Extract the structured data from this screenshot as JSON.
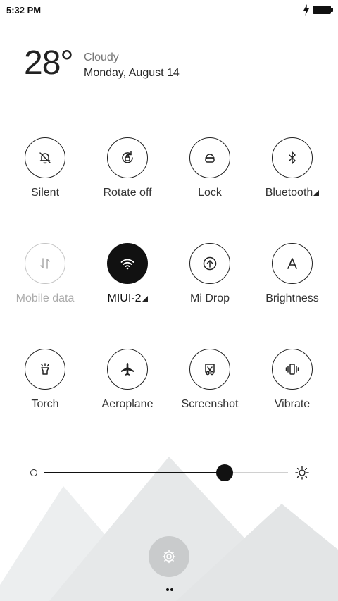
{
  "status_bar": {
    "time": "5:32 PM",
    "charging": true,
    "battery_percent": 100
  },
  "weather": {
    "temperature": "28°",
    "condition": "Cloudy",
    "date": "Monday, August 14"
  },
  "toggles": [
    {
      "id": "silent",
      "label": "Silent",
      "icon": "bell-off-icon",
      "state": "off"
    },
    {
      "id": "rotate",
      "label": "Rotate off",
      "icon": "rotate-lock-icon",
      "state": "off"
    },
    {
      "id": "lock",
      "label": "Lock",
      "icon": "lock-icon",
      "state": "off"
    },
    {
      "id": "bluetooth",
      "label": "Bluetooth",
      "icon": "bluetooth-icon",
      "state": "off",
      "has_submenu": true
    },
    {
      "id": "mobile_data",
      "label": "Mobile data",
      "icon": "data-arrows-icon",
      "state": "disabled"
    },
    {
      "id": "wifi",
      "label": "MIUI-2",
      "icon": "wifi-icon",
      "state": "on",
      "has_submenu": true
    },
    {
      "id": "mi_drop",
      "label": "Mi Drop",
      "icon": "upload-icon",
      "state": "off"
    },
    {
      "id": "brightness",
      "label": "Brightness",
      "icon": "auto-brightness-icon",
      "state": "off"
    },
    {
      "id": "torch",
      "label": "Torch",
      "icon": "flashlight-icon",
      "state": "off"
    },
    {
      "id": "aeroplane",
      "label": "Aeroplane",
      "icon": "airplane-icon",
      "state": "off"
    },
    {
      "id": "screenshot",
      "label": "Screenshot",
      "icon": "scissors-icon",
      "state": "off"
    },
    {
      "id": "vibrate",
      "label": "Vibrate",
      "icon": "vibrate-icon",
      "state": "off"
    }
  ],
  "brightness_slider": {
    "value": 0.74
  },
  "page_indicator": {
    "current": 1,
    "total": 2
  },
  "colors": {
    "active": "#111111",
    "disabled": "#aaaaaa",
    "settings_button": "#c9cbcc"
  }
}
